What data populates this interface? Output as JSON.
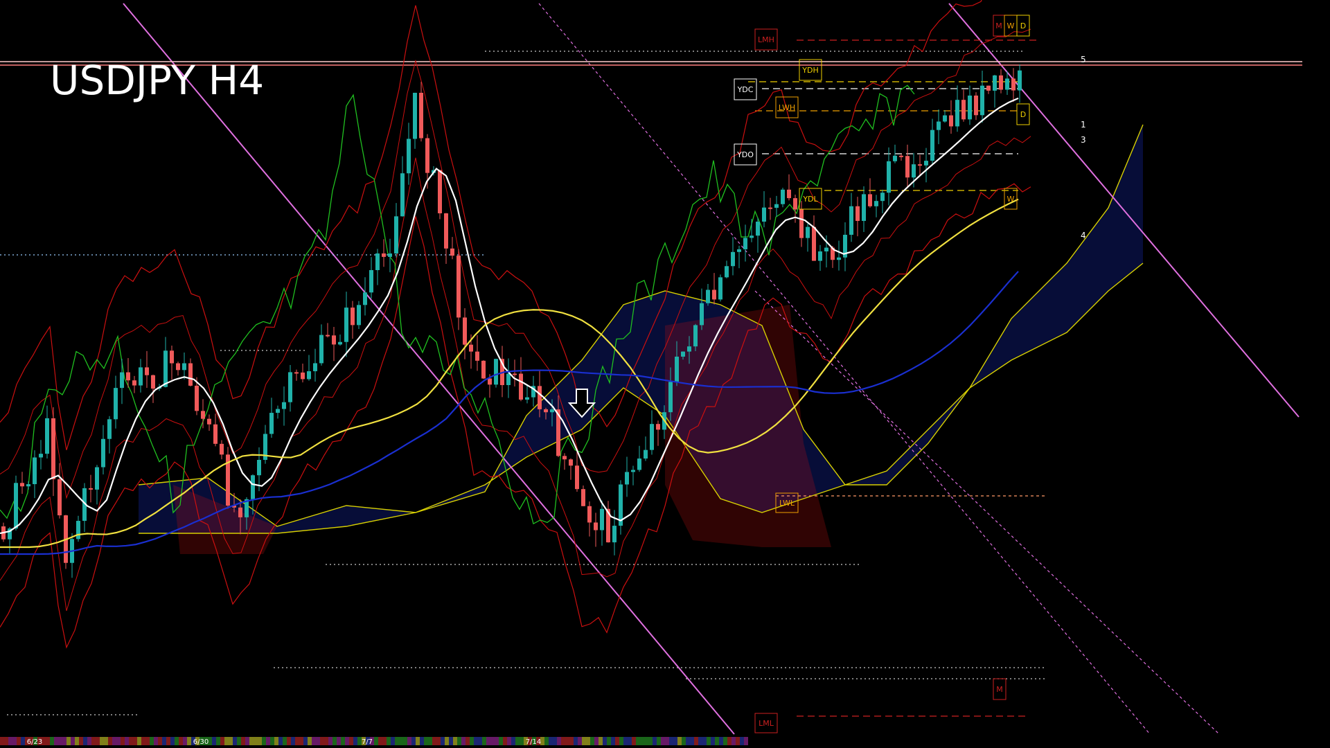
{
  "chart_data": {
    "type": "candlestick",
    "title": "USDJPY H4",
    "x_tick_labels": [
      "6/23",
      "6/30",
      "7/7",
      "7/14"
    ],
    "level_tags": {
      "ydh": "YDH",
      "ydc": "YDC",
      "ydo": "YDO",
      "ydl": "YDL",
      "lwh": "LWH",
      "lwl": "LWL",
      "lmh": "LMH",
      "lml": "LML",
      "m": "M",
      "w": "W",
      "d": "D"
    },
    "wave_labels": [
      "5",
      "1",
      "3",
      "4"
    ],
    "colors": {
      "background": "#000000",
      "bull": "#20b2aa",
      "bear": "#f05a5a",
      "cloud_blue": "#1e3cff",
      "cloud_red": "#c01010",
      "ma_white": "#ffffff",
      "ma_yellow": "#f0e040",
      "ma_blue": "#1a2fd0",
      "bollinger": "#cc1010",
      "chikou": "#20c020",
      "senkou": "#d8d000",
      "channel": "#e070e0"
    },
    "indicators": [
      "candles",
      "moving averages",
      "bollinger bands",
      "ichimoku cloud",
      "pivot levels"
    ]
  }
}
